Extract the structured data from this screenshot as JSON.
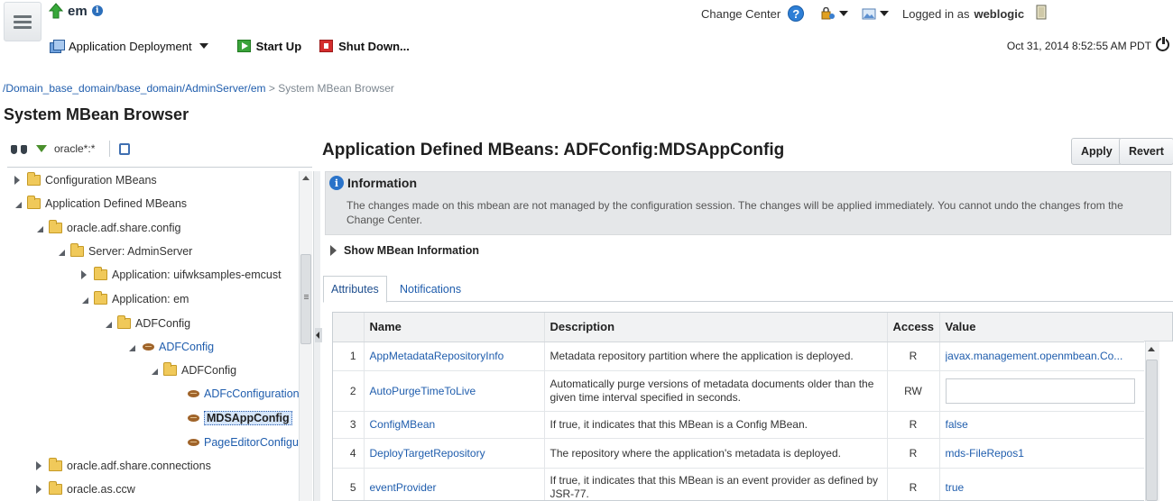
{
  "header": {
    "app_name": "em",
    "change_center": "Change Center",
    "logged_in_label": "Logged in as",
    "user": "weblogic"
  },
  "toolbar": {
    "deployment_menu": "Application Deployment",
    "start_up": "Start Up",
    "shut_down": "Shut Down...",
    "timestamp": "Oct 31, 2014 8:52:55 AM PDT"
  },
  "breadcrumb": {
    "link": "/Domain_base_domain/base_domain/AdminServer/em",
    "separator": ">",
    "current": "System MBean Browser"
  },
  "page_title": "System MBean Browser",
  "tree": {
    "filter": "oracle*:*",
    "items": [
      {
        "label": "Configuration MBeans"
      },
      {
        "label": "Application Defined MBeans"
      },
      {
        "label": "oracle.adf.share.config"
      },
      {
        "label": "Server: AdminServer"
      },
      {
        "label": "Application: uifwksamples-emcust"
      },
      {
        "label": "Application: em"
      },
      {
        "label": "ADFConfig"
      },
      {
        "label": "ADFConfig"
      },
      {
        "label": "ADFConfig"
      },
      {
        "label": "ADFcConfiguration"
      },
      {
        "label": "MDSAppConfig"
      },
      {
        "label": "PageEditorConfigu"
      },
      {
        "label": "oracle.adf.share.connections"
      },
      {
        "label": "oracle.as.ccw"
      }
    ]
  },
  "content": {
    "title": "Application Defined MBeans: ADFConfig:MDSAppConfig",
    "apply": "Apply",
    "revert": "Revert",
    "info_title": "Information",
    "info_message": "The changes made on this mbean are not managed by the configuration session. The changes will be applied immediately. You cannot undo the changes from the Change Center.",
    "show_info": "Show MBean Information",
    "tabs": [
      "Attributes",
      "Notifications"
    ],
    "columns": [
      "Name",
      "Description",
      "Access",
      "Value"
    ],
    "rows": [
      {
        "num": "1",
        "name": "AppMetadataRepositoryInfo",
        "description": "Metadata repository partition where the application is deployed.",
        "access": "R",
        "value": "javax.management.openmbean.Co..."
      },
      {
        "num": "2",
        "name": "AutoPurgeTimeToLive",
        "description": "Automatically purge versions of metadata documents older than the given time interval specified in seconds.",
        "access": "RW",
        "value": ""
      },
      {
        "num": "3",
        "name": "ConfigMBean",
        "description": "If true, it indicates that this MBean is a Config MBean.",
        "access": "R",
        "value": "false"
      },
      {
        "num": "4",
        "name": "DeployTargetRepository",
        "description": "The repository where the application's metadata is deployed.",
        "access": "R",
        "value": "mds-FileRepos1"
      },
      {
        "num": "5",
        "name": "eventProvider",
        "description": "If true, it indicates that this MBean is an event provider as defined by JSR-77.",
        "access": "R",
        "value": "true"
      }
    ]
  },
  "colors": {
    "link": "#1f5dad",
    "info_bg": "#e5e7e9",
    "start_green": "#3aa33a",
    "stop_red": "#d42d2d"
  }
}
